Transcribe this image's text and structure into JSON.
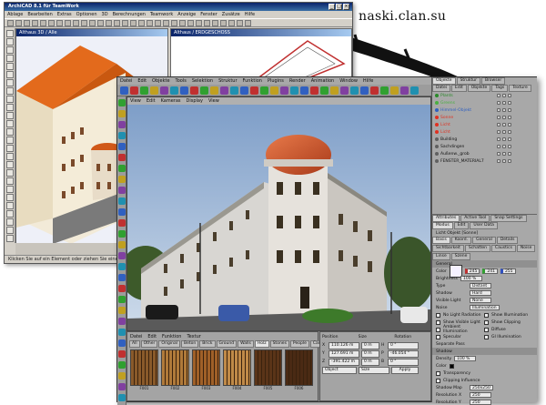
{
  "site_label": "naski.clan.su",
  "archicad": {
    "title": "ArchiCAD 8.1 für TeamWork",
    "menu": [
      "Ablage",
      "Bearbeiten",
      "Extras",
      "Optionen",
      "3D",
      "Berechnungen",
      "Teamwork",
      "Anzeige",
      "Fenster",
      "Zusätze",
      "Hilfe"
    ],
    "window_3d_title": "Althaus 3D / Alle",
    "window_2d_title": "Althaus / ERDGESCHOSS",
    "status": "Klicken Sie auf ein Element oder ziehen Sie einen Auswahlbereich auf."
  },
  "c4d": {
    "menu": [
      "Datei",
      "Edit",
      "Objekte",
      "Tools",
      "Selektion",
      "Struktur",
      "Funktion",
      "Plugins",
      "Render",
      "Animation",
      "Window",
      "Hilfe"
    ],
    "viewport_title": "View",
    "viewport_menu": [
      "Edit",
      "Kameras",
      "Display",
      "View"
    ],
    "object_tabs": [
      "Objekte",
      "Struktur",
      "Browser"
    ],
    "object_subtabs": [
      "Datei",
      "Edit",
      "Objekte",
      "Tags",
      "Texture"
    ],
    "objects": [
      {
        "name": "Plants",
        "color": "#2a8a2a"
      },
      {
        "name": "Greens",
        "color": "#4ab040"
      },
      {
        "name": "Himmel-Objekt",
        "color": "#3060c0"
      },
      {
        "name": "Sonne",
        "color": "#e03020"
      },
      {
        "name": "Licht",
        "color": "#e03020"
      },
      {
        "name": "Licht",
        "color": "#e03020"
      },
      {
        "name": "Building",
        "color": "#606060"
      },
      {
        "name": "Sachdingen",
        "color": "#606060"
      },
      {
        "name": "Außenw._grob",
        "color": "#606060"
      },
      {
        "name": "FENSTER_MATERIAL7",
        "color": "#606060"
      }
    ],
    "attr_tabs": [
      "Attributes",
      "Active Tool",
      "Snap Settings"
    ],
    "attr_subtabs": [
      "Modus",
      "Edit",
      "User Data"
    ],
    "attr_object": "Licht Objekt [Sonne]",
    "attr_section_tabs": [
      "Basis",
      "Koord.",
      "General",
      "Details",
      "Sichtbarkeit",
      "Schatten",
      "Caustics",
      "Noise",
      "Linse",
      "Szene"
    ],
    "general_label": "General",
    "color_label": "Color",
    "rgb": [
      "245",
      "241",
      "255"
    ],
    "brightness_label": "Brightness",
    "brightness_value": "100 %",
    "type_label": "Type",
    "type_value": "Distant",
    "shadow_label": "Shadow",
    "shadow_value": "Hard",
    "visible_light_label": "Visible Light",
    "visible_light_value": "None",
    "noise_label": "Noise",
    "noise_value": "Illumination",
    "checks": [
      "No Light Radiation",
      "Show Illumination",
      "Show Visible Light",
      "Show Clipping",
      "Ambient Illumination",
      "Diffuse",
      "Specular",
      "GI Illumination"
    ],
    "separate_pass": "Separate Pass",
    "shadow_section": "Shadow",
    "density_label": "Density",
    "density_value": "100 %",
    "color_shadow": "Color",
    "transparency": "Transparency",
    "clipping": "Clipping Influence",
    "shadow_map_label": "Shadow Map",
    "shadow_map_value": "250x250",
    "res_x": "Resolution X",
    "res_x_value": "250",
    "res_y": "Resolution Y",
    "res_y_value": "250",
    "memory_label": "Memory Usage",
    "memory_value": "ca. 0.5 MB",
    "sample_label": "Sample Radius",
    "sample_value": "3",
    "mat_menu": [
      "Datei",
      "Edit",
      "Funktion",
      "Textur"
    ],
    "mat_tabs": [
      "All",
      "Other",
      "Original",
      "Beton",
      "Brick",
      "Ground",
      "Walls",
      "Holz",
      "Stones",
      "People",
      "Car"
    ],
    "mat_active": "Holz",
    "materials": [
      "F001",
      "F002",
      "F003",
      "F004",
      "F005",
      "F006"
    ],
    "coord_headers": [
      "Position",
      "Size",
      "Rotation"
    ],
    "coord_rows": [
      [
        "X",
        "110.126 m",
        "0 m",
        "H",
        "0 °"
      ],
      [
        "Y",
        "127.691 m",
        "0 m",
        "P",
        "-46.054 °"
      ],
      [
        "Z",
        "-391.422 m",
        "0 m",
        "B",
        "0 °"
      ]
    ],
    "coord_mode": "Object",
    "coord_size_mode": "Size",
    "apply": "Apply",
    "timeline_frame": "0 F"
  },
  "colors": {
    "c4d_bg": "#8e8e8e",
    "win_title": "#0a246a",
    "roof": "#e06a20"
  }
}
